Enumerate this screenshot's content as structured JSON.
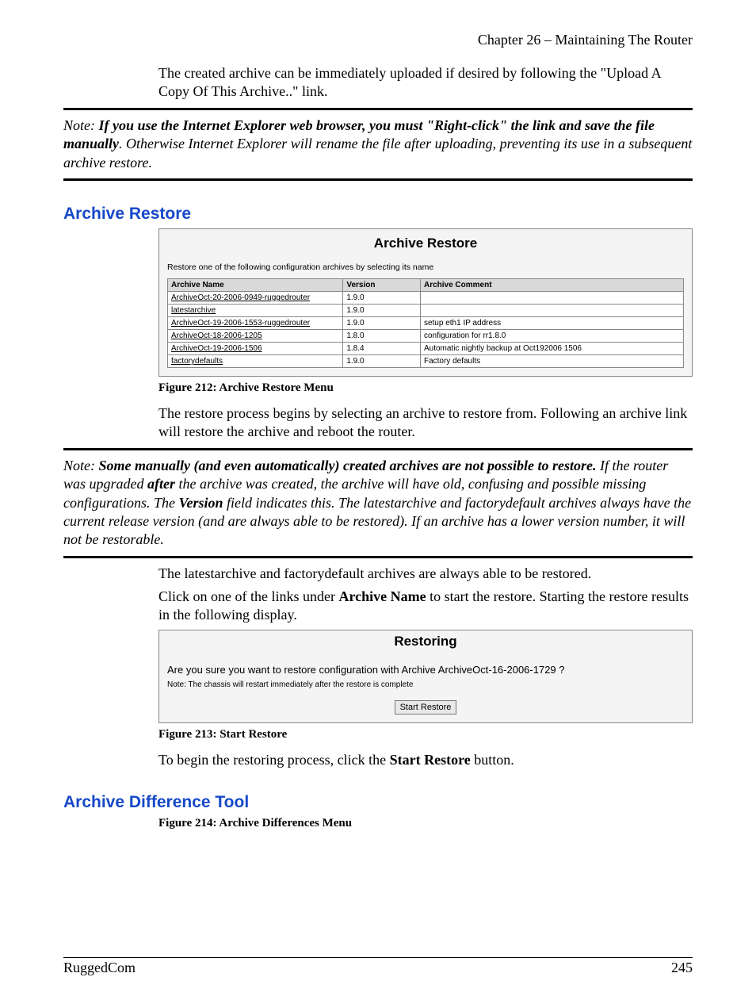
{
  "chapter_header": "Chapter 26 – Maintaining The Router",
  "intro_para": "The created archive can be immediately uploaded if desired by following the \"Upload A Copy Of This Archive..\" link.",
  "note1": {
    "prefix": "Note:  ",
    "bold_lead": "If you use the Internet Explorer web browser, you must \"Right-click\" the link and save the file manually",
    "tail": ".  Otherwise Internet Explorer will rename the file after uploading, preventing its use in a subsequent archive restore."
  },
  "section1_title": "Archive Restore",
  "panel1": {
    "title": "Archive Restore",
    "desc": "Restore one of the following configuration archives by selecting its name",
    "headers": {
      "name": "Archive Name",
      "version": "Version",
      "comment": "Archive Comment"
    },
    "rows": [
      {
        "name": "ArchiveOct-20-2006-0949-ruggedrouter",
        "version": "1.9.0",
        "comment": ""
      },
      {
        "name": "latestarchive",
        "version": "1.9.0",
        "comment": ""
      },
      {
        "name": "ArchiveOct-19-2006-1553-ruggedrouter",
        "version": "1.9.0",
        "comment": "setup eth1 IP address"
      },
      {
        "name": "ArchiveOct-18-2006-1205",
        "version": "1.8.0",
        "comment": "configuration for rr1.8.0"
      },
      {
        "name": "ArchiveOct-19-2006-1506",
        "version": "1.8.4",
        "comment": "Automatic nightly backup at Oct192006 1506"
      },
      {
        "name": "factorydefaults",
        "version": "1.9.0",
        "comment": "Factory defaults"
      }
    ]
  },
  "figure212": "Figure 212: Archive Restore Menu",
  "para_after_fig212": "The restore process begins by selecting an archive to restore from.  Following an archive link will restore the archive and reboot the router.",
  "note2": {
    "prefix": "Note:  ",
    "bold1": "Some manually (and even automatically) created archives are not possible to restore.",
    "mid1": " If the router was upgraded ",
    "bold2": "after",
    "mid2": " the archive was created, the archive will have old, confusing and possible missing configurations.  The ",
    "bold3": "Version",
    "tail": " field indicates this.  The latestarchive and factorydefault archives always have the current release version (and are always able to be restored).  If an archive has a lower version number, it will not be restorable."
  },
  "para_latest": "The latestarchive and factorydefault archives are always able to be restored.",
  "para_click_pre": "Click on one of the links under ",
  "para_click_bold": "Archive Name",
  "para_click_post": " to start the restore. Starting the restore results in the following display.",
  "panel2": {
    "title": "Restoring",
    "question": "Are you sure you want to restore configuration with Archive ArchiveOct-16-2006-1729 ?",
    "note": "Note: The chassis will restart immediately after the restore is complete",
    "button": "Start Restore"
  },
  "figure213": "Figure 213: Start Restore",
  "para_begin_pre": "To begin the restoring process, click the ",
  "para_begin_bold": "Start Restore",
  "para_begin_post": " button.",
  "section2_title": "Archive Difference Tool",
  "figure214": "Figure 214: Archive Differences Menu",
  "footer_left": "RuggedCom",
  "footer_right": "245"
}
